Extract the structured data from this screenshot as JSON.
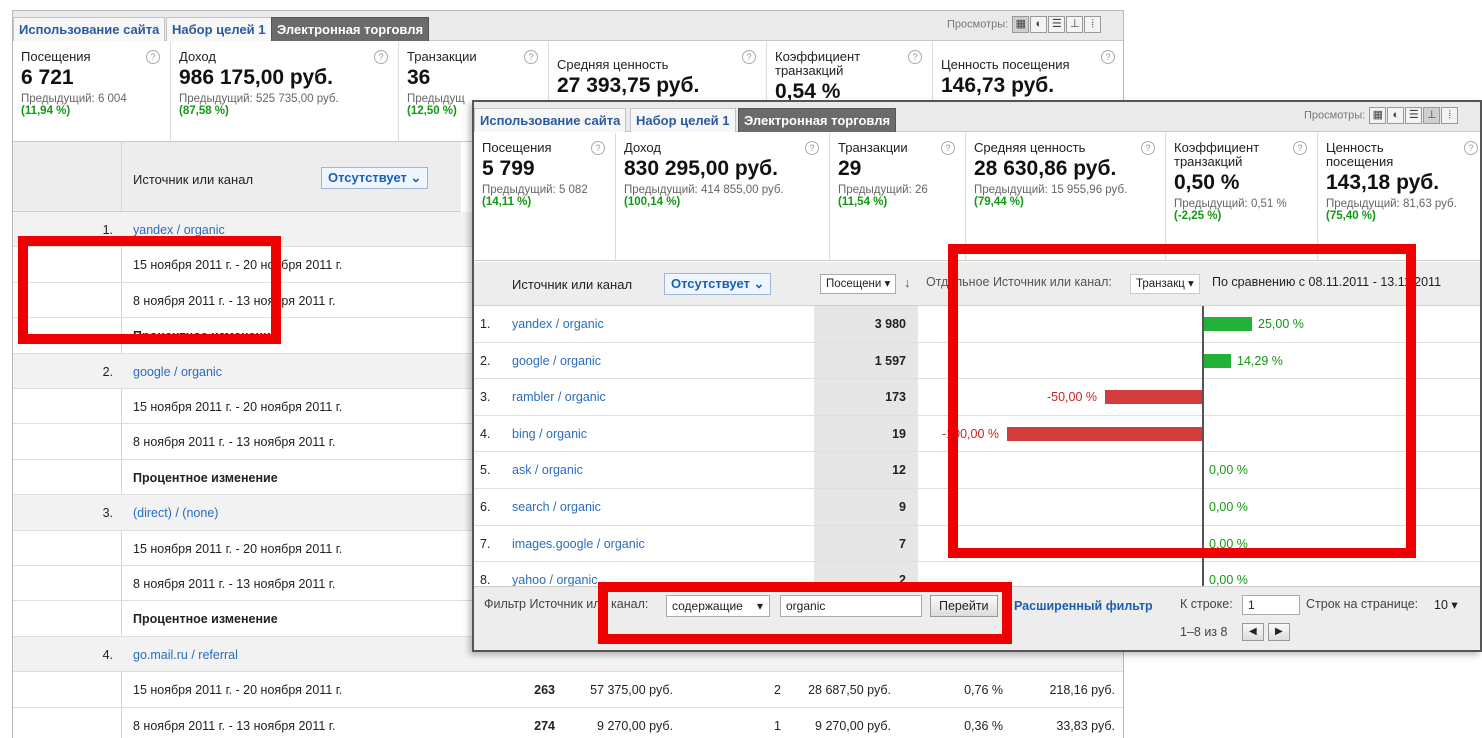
{
  "back": {
    "tabs": [
      "Использование сайта",
      "Набор целей 1",
      "Электронная торговля"
    ],
    "views_label": "Просмотры:",
    "metrics": [
      {
        "label": "Посещения",
        "value": "6 721",
        "prev": "Предыдущий: 6 004",
        "pct": "(11,94 %)"
      },
      {
        "label": "Доход",
        "value": "986 175,00 руб.",
        "prev": "Предыдущий: 525 735,00 руб.",
        "pct": "(87,58 %)"
      },
      {
        "label": "Транзакции",
        "value": "36",
        "prev": "Предыдущ",
        "pct": "(12,50 %)"
      },
      {
        "label": "Средняя ценность",
        "value": "27 393,75 руб.",
        "prev": "",
        "pct": ""
      },
      {
        "label": "Коэффициент транзакций",
        "value": "0,54 %",
        "prev": "",
        "pct": ""
      },
      {
        "label": "Ценность посещения",
        "value": "146,73 руб.",
        "prev": "",
        "pct": ""
      }
    ],
    "header_label": "Источник или канал",
    "secondary_button": "Отсутствует",
    "rows": [
      {
        "kind": "source",
        "index": "1.",
        "text": "yandex / organic"
      },
      {
        "kind": "date",
        "text": "15 ноября 2011 г. - 20 ноября 2011 г."
      },
      {
        "kind": "date",
        "text": "8 ноября 2011 г. - 13 ноября 2011 г."
      },
      {
        "kind": "pct",
        "text": "Процентное изменение"
      },
      {
        "kind": "source",
        "index": "2.",
        "text": "google / organic"
      },
      {
        "kind": "date",
        "text": "15 ноября 2011 г. - 20 ноября 2011 г."
      },
      {
        "kind": "date",
        "text": "8 ноября 2011 г. - 13 ноября 2011 г."
      },
      {
        "kind": "pct",
        "text": "Процентное изменение"
      },
      {
        "kind": "source",
        "index": "3.",
        "text": "(direct) / (none)"
      },
      {
        "kind": "date",
        "text": "15 ноября 2011 г. - 20 ноября 2011 г."
      },
      {
        "kind": "date",
        "text": "8 ноября 2011 г. - 13 ноября 2011 г."
      },
      {
        "kind": "pct",
        "text": "Процентное изменение"
      },
      {
        "kind": "source",
        "index": "4.",
        "text": "go.mail.ru / referral"
      },
      {
        "kind": "date",
        "text": "15 ноября 2011 г. - 20 ноября 2011 г.",
        "vals": [
          "263",
          "57 375,00 руб.",
          "2",
          "28 687,50 руб.",
          "0,76 %",
          "218,16 руб."
        ]
      },
      {
        "kind": "date",
        "text": "8 ноября 2011 г. - 13 ноября 2011 г.",
        "vals": [
          "274",
          "9 270,00 руб.",
          "1",
          "9 270,00 руб.",
          "0,36 %",
          "33,83 руб."
        ]
      }
    ]
  },
  "front": {
    "tabs": [
      "Использование сайта",
      "Набор целей 1",
      "Электронная торговля"
    ],
    "views_label": "Просмотры:",
    "metrics": [
      {
        "label": "Посещения",
        "value": "5 799",
        "prev": "Предыдущий: 5 082",
        "pct": "(14,11 %)"
      },
      {
        "label": "Доход",
        "value": "830 295,00 руб.",
        "prev": "Предыдущий: 414 855,00 руб.",
        "pct": "(100,14 %)"
      },
      {
        "label": "Транзакции",
        "value": "29",
        "prev": "Предыдущий: 26",
        "pct": "(11,54 %)"
      },
      {
        "label": "Средняя ценность",
        "value": "28 630,86 руб.",
        "prev": "Предыдущий: 15 955,96 руб.",
        "pct": "(79,44 %)"
      },
      {
        "label": "Коэффициент транзакций",
        "value": "0,50 %",
        "prev": "Предыдущий: 0,51 %",
        "pct": "(-2,25 %)"
      },
      {
        "label": "Ценность посещения",
        "value": "143,18 руб.",
        "prev": "Предыдущий: 81,63 руб.",
        "pct": "(75,40 %)"
      }
    ],
    "header_label": "Источник или канал",
    "secondary_button": "Отсутствует",
    "sort_select": "Посещени",
    "compare_prefix": "Отдельное Источник или канал:",
    "compare_select": "Транзакц",
    "compare_text": "По сравнению с 08.11.2011 - 13.11.2011",
    "rows": [
      {
        "index": "1.",
        "source": "yandex / organic",
        "visits": "3 980",
        "change_label": "25,00 %",
        "change": 25.0
      },
      {
        "index": "2.",
        "source": "google / organic",
        "visits": "1 597",
        "change_label": "14,29 %",
        "change": 14.29
      },
      {
        "index": "3.",
        "source": "rambler / organic",
        "visits": "173",
        "change_label": "-50,00 %",
        "change": -50.0
      },
      {
        "index": "4.",
        "source": "bing / organic",
        "visits": "19",
        "change_label": "-100,00 %",
        "change": -100.0
      },
      {
        "index": "5.",
        "source": "ask / organic",
        "visits": "12",
        "change_label": "0,00 %",
        "change": 0
      },
      {
        "index": "6.",
        "source": "search / organic",
        "visits": "9",
        "change_label": "0,00 %",
        "change": 0
      },
      {
        "index": "7.",
        "source": "images.google / organic",
        "visits": "7",
        "change_label": "0,00 %",
        "change": 0
      },
      {
        "index": "8.",
        "source": "yahoo / organic",
        "visits": "2",
        "change_label": "0,00 %",
        "change": 0
      }
    ],
    "footer": {
      "filter_label": "Фильтр Источник или канал:",
      "filter_mode": "содержащие",
      "filter_value": "organic",
      "go_button": "Перейти",
      "advanced_filter": "Расширенный фильтр",
      "goto_row_label": "К строке:",
      "goto_row_value": "1",
      "range_text": "1–8 из 8",
      "rows_per_page_label": "Строк на странице:",
      "rows_per_page_value": "10"
    }
  },
  "colors": {
    "positive_bar": "#22b23a",
    "negative_bar": "#d23c3c",
    "highlight_box": "#ee0000",
    "link": "#2a6dbd"
  }
}
